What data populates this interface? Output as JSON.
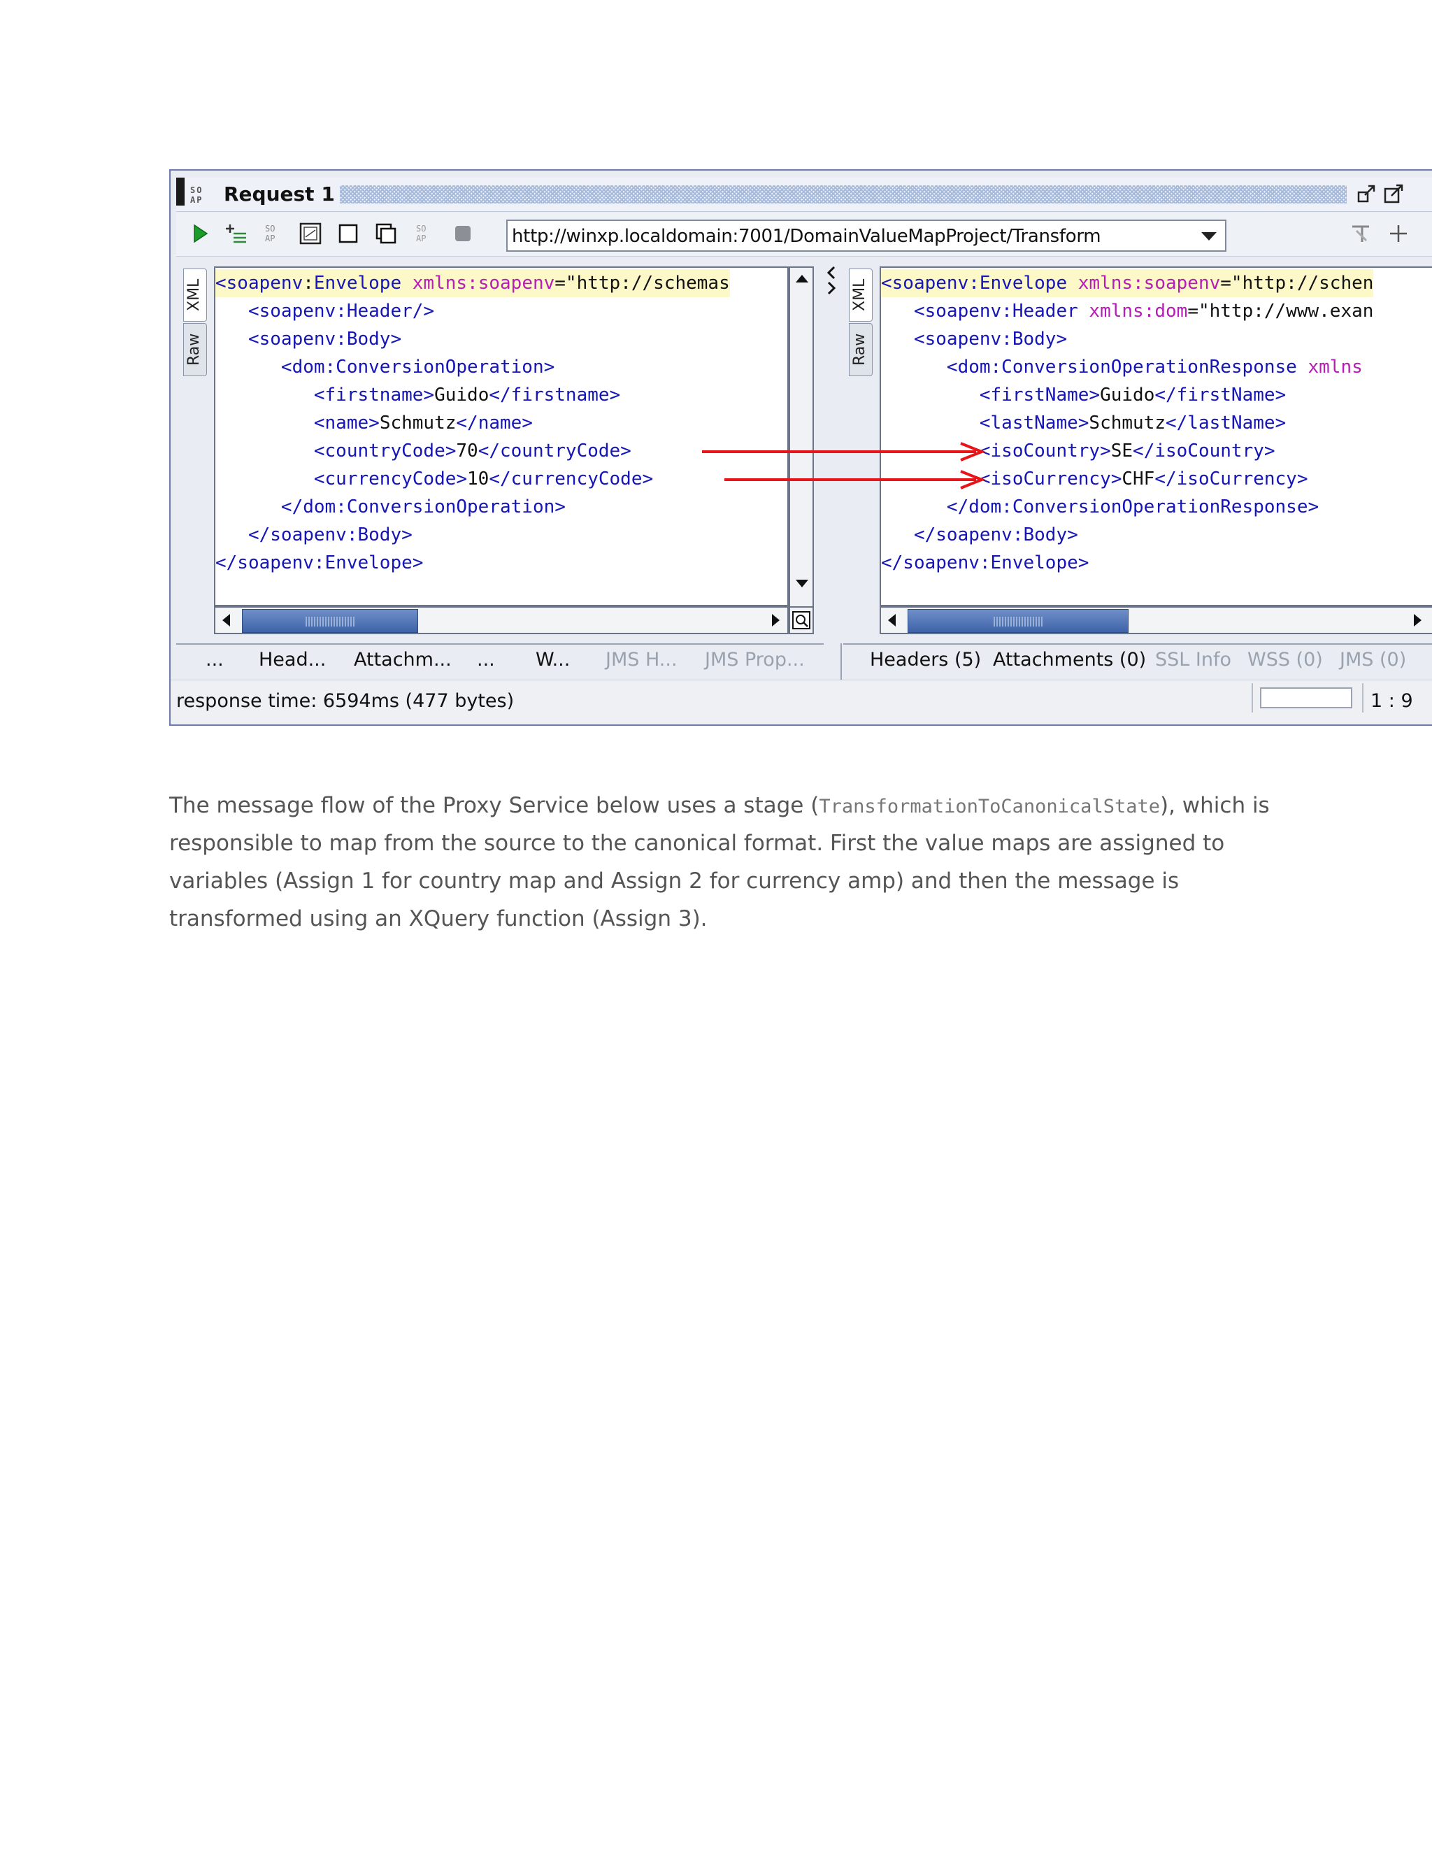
{
  "window": {
    "title": "Request 1",
    "soap_logo": "SOAP",
    "url": "http://winxp.localdomain:7001/DomainValueMapProject/Transform"
  },
  "side_tabs": {
    "xml": "XML",
    "raw": "Raw"
  },
  "request_xml": {
    "lines": [
      [
        [
          "tag",
          "<soapenv"
        ],
        [
          "txt",
          ":"
        ],
        [
          "tag",
          "Envelope "
        ],
        [
          "attr",
          "xmlns:soapenv"
        ],
        [
          "str",
          "=\"http://schemas"
        ]
      ],
      [
        [
          "tag",
          "   <soapenv:Header/>"
        ]
      ],
      [
        [
          "tag",
          "   <soapenv:Body>"
        ]
      ],
      [
        [
          "tag",
          "      <dom:ConversionOperation>"
        ]
      ],
      [
        [
          "tag",
          "         <firstname>"
        ],
        [
          "txt",
          "Guido"
        ],
        [
          "tag",
          "</firstname>"
        ]
      ],
      [
        [
          "tag",
          "         <name>"
        ],
        [
          "txt",
          "Schmutz"
        ],
        [
          "tag",
          "</name>"
        ]
      ],
      [
        [
          "tag",
          "         <countryCode>"
        ],
        [
          "txt",
          "70"
        ],
        [
          "tag",
          "</countryCode>"
        ]
      ],
      [
        [
          "tag",
          "         <currencyCode>"
        ],
        [
          "txt",
          "10"
        ],
        [
          "tag",
          "</currencyCode>"
        ]
      ],
      [
        [
          "tag",
          "      </dom:ConversionOperation>"
        ]
      ],
      [
        [
          "tag",
          "   </soapenv:Body>"
        ]
      ],
      [
        [
          "tag",
          "</soapenv:Envelope>"
        ]
      ]
    ]
  },
  "response_xml": {
    "lines": [
      [
        [
          "tag",
          "<soapenv:Envelope "
        ],
        [
          "attr",
          "xmlns:soapenv"
        ],
        [
          "str",
          "=\"http://schen"
        ]
      ],
      [
        [
          "tag",
          "   <soapenv:Header "
        ],
        [
          "attr",
          "xmlns:dom"
        ],
        [
          "str",
          "=\"http://www.exan"
        ]
      ],
      [
        [
          "tag",
          "   <soapenv:Body>"
        ]
      ],
      [
        [
          "tag",
          "      <dom:ConversionOperationResponse "
        ],
        [
          "attr",
          "xmlns"
        ]
      ],
      [
        [
          "tag",
          "         <firstName>"
        ],
        [
          "txt",
          "Guido"
        ],
        [
          "tag",
          "</firstName>"
        ]
      ],
      [
        [
          "tag",
          "         <lastName>"
        ],
        [
          "txt",
          "Schmutz"
        ],
        [
          "tag",
          "</lastName>"
        ]
      ],
      [
        [
          "tag",
          "         <isoCountry>"
        ],
        [
          "txt",
          "SE"
        ],
        [
          "tag",
          "</isoCountry>"
        ]
      ],
      [
        [
          "tag",
          "         <isoCurrency>"
        ],
        [
          "txt",
          "CHF"
        ],
        [
          "tag",
          "</isoCurrency>"
        ]
      ],
      [
        [
          "tag",
          "      </dom:ConversionOperationResponse>"
        ]
      ],
      [
        [
          "tag",
          "   </soapenv:Body>"
        ]
      ],
      [
        [
          "tag",
          "</soapenv:Envelope>"
        ]
      ]
    ]
  },
  "request_tabs": {
    "t1": "...",
    "t2": "Head...",
    "t3": "Attachm...",
    "t4": "...",
    "t5": "W...",
    "t6": "JMS H...",
    "t7": "JMS Prop..."
  },
  "response_tabs": {
    "headers": "Headers (5)",
    "attachments": "Attachments (0)",
    "ssl": "SSL Info",
    "wss": "WSS (0)",
    "jms": "JMS (0)"
  },
  "status": {
    "response_time": "response time: 6594ms (477 bytes)",
    "cursor": "1 : 9"
  },
  "paragraph": {
    "before_code": "The message flow of the Proxy Service below uses a stage (",
    "code": "TransformationToCanonicalState",
    "after_code": "), which is responsible to map from the source to the canonical format. First the value maps are assigned to variables (Assign 1 for country map and Assign 2 for currency amp) and then the message is transformed using an XQuery function (Assign 3)."
  },
  "colors": {
    "tag": "#1515b8",
    "attr": "#b51db5",
    "arrow": "#e8141a",
    "scroll_thumb": "#4a6db0"
  },
  "icons": [
    "soap-icon",
    "run-icon",
    "add-step-icon",
    "soap-small-icon",
    "frame-icon",
    "square-icon",
    "copy-icon",
    "soap-grey-icon",
    "stop-icon",
    "minimize-icon",
    "maximize-icon",
    "settings-icon",
    "plus-icon"
  ]
}
